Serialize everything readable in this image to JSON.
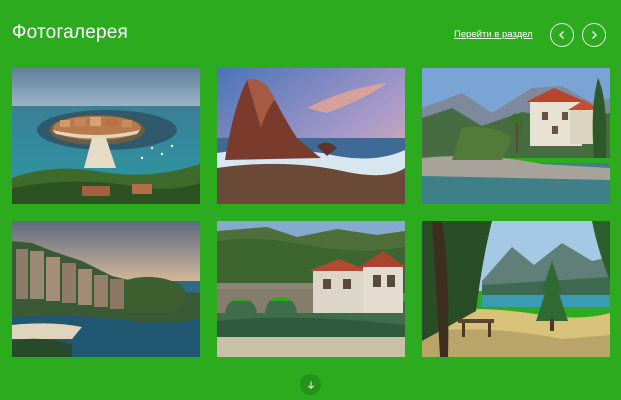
{
  "header": {
    "title": "Фотогалерея",
    "section_link": "Перейти в раздел"
  },
  "navigation": {
    "prev_icon": "chevron-left-icon",
    "next_icon": "chevron-right-icon"
  },
  "gallery": {
    "photos": [
      {
        "subject": "island-town-sea"
      },
      {
        "subject": "sea-rock-sunset"
      },
      {
        "subject": "coastal-village-mountains"
      },
      {
        "subject": "hillside-resort-bay"
      },
      {
        "subject": "stone-bridge-river"
      },
      {
        "subject": "mountain-lake-forest"
      }
    ]
  },
  "load_more": {
    "icon": "arrow-down-icon"
  },
  "colors": {
    "background": "#2cab1f",
    "text": "#ffffff"
  }
}
